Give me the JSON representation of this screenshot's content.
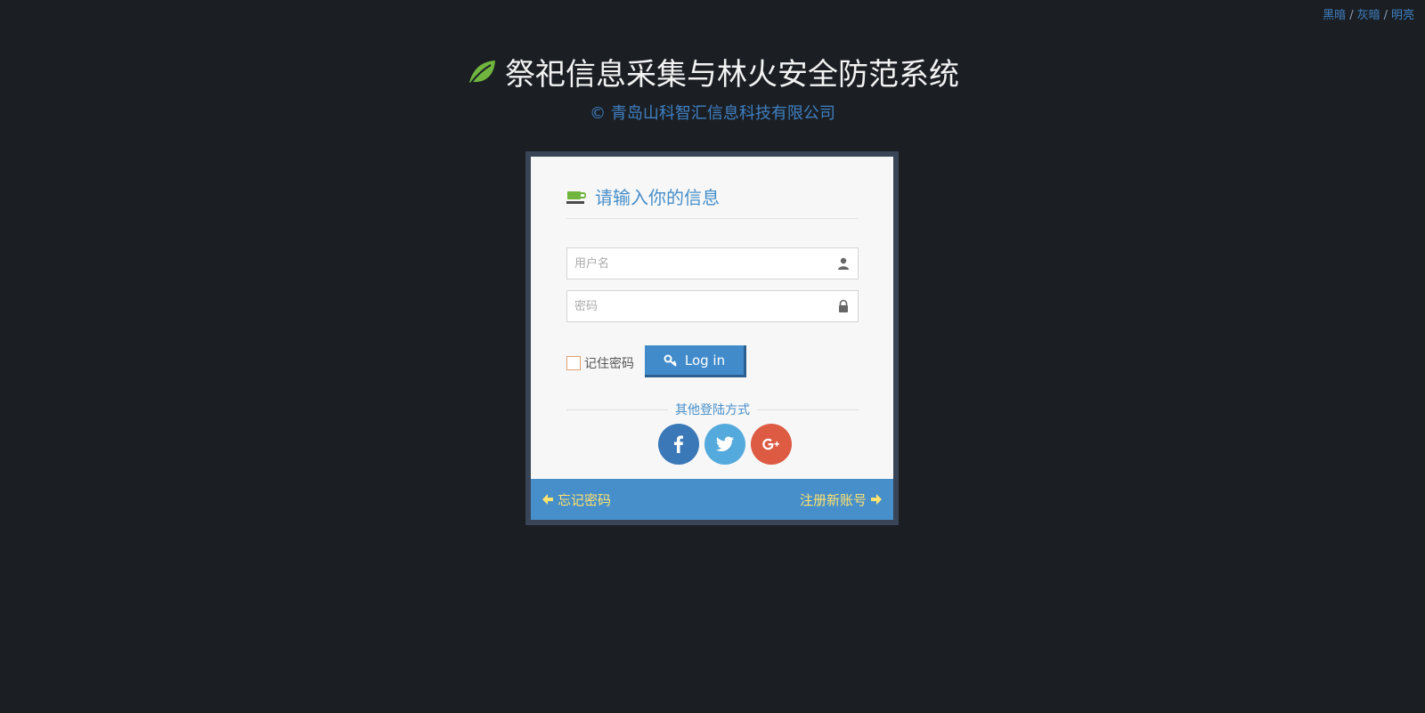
{
  "theme_switch": {
    "items": [
      "黑暗",
      "灰暗",
      "明亮"
    ],
    "separator": "/"
  },
  "brand": {
    "title": "祭祀信息采集与林火安全防范系统",
    "subtitle": "© 青岛山科智汇信息科技有限公司",
    "icon": "leaf-icon",
    "icon_color": "#6fb53e"
  },
  "login": {
    "header": "请输入你的信息",
    "header_icon": "coffee-icon",
    "username_placeholder": "用户名",
    "password_placeholder": "密码",
    "remember_label": "记住密码",
    "login_button": "Log in",
    "other_methods": "其他登陆方式",
    "socials": [
      "facebook-icon",
      "twitter-icon",
      "google-plus-icon"
    ],
    "forgot_password": "忘记密码",
    "register": "注册新账号"
  },
  "colors": {
    "background": "#1b1f24",
    "accent": "#478fca",
    "footer_link": "#fde26f",
    "facebook": "#3b78b8",
    "twitter": "#55aadd",
    "google_plus": "#dd5a43"
  }
}
